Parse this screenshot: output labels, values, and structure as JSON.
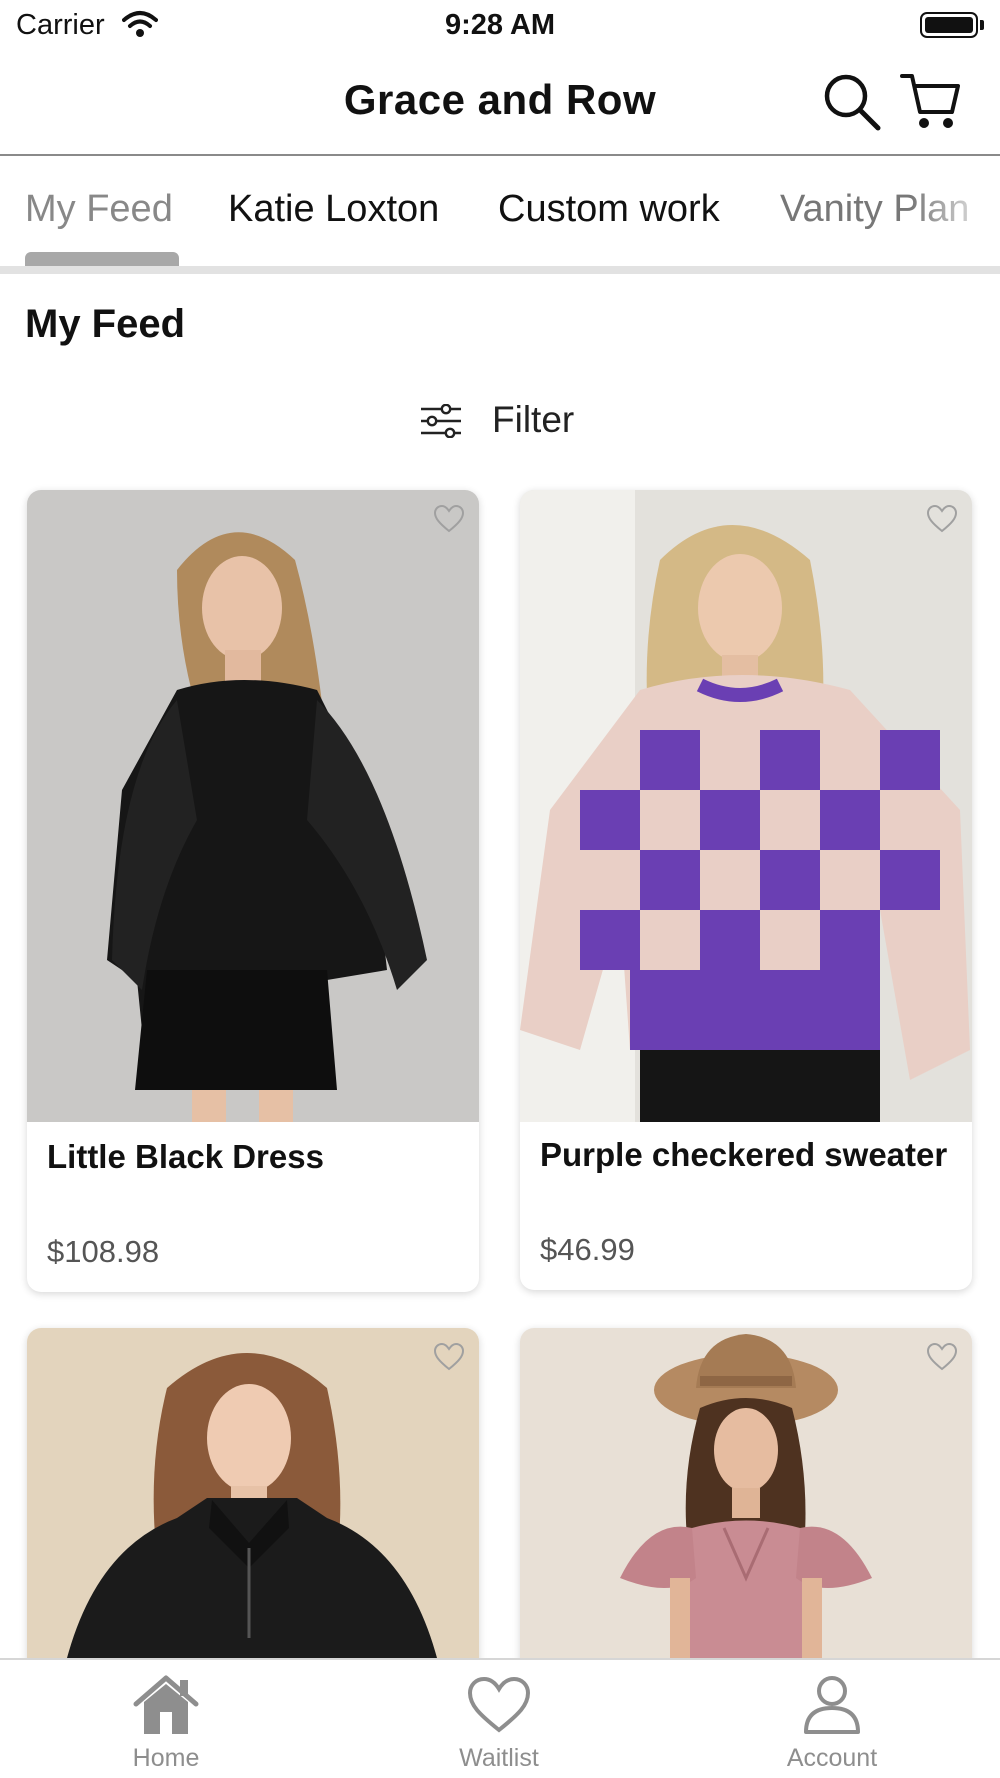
{
  "status_bar": {
    "carrier": "Carrier",
    "time": "9:28 AM"
  },
  "nav": {
    "title": "Grace and Row",
    "search_icon": "search-icon",
    "cart_icon": "cart-icon"
  },
  "tabs": [
    {
      "label": "My Feed",
      "active": true
    },
    {
      "label": "Katie Loxton",
      "active": false
    },
    {
      "label": "Custom work",
      "active": false
    },
    {
      "label": "Vanity Plan",
      "active": false
    }
  ],
  "section": {
    "title": "My Feed",
    "filter_label": "Filter",
    "filter_icon": "sliders-icon"
  },
  "products": [
    {
      "name": "Little Black Dress",
      "price": "$108.98",
      "favorite": false
    },
    {
      "name": "Purple checkered sweater",
      "price": "$46.99",
      "favorite": false
    },
    {
      "name": "",
      "price": "",
      "favorite": false
    },
    {
      "name": "",
      "price": "",
      "favorite": false
    }
  ],
  "tab_bar": [
    {
      "label": "Home",
      "icon": "home-icon"
    },
    {
      "label": "Waitlist",
      "icon": "heart-icon"
    },
    {
      "label": "Account",
      "icon": "person-icon"
    }
  ],
  "colors": {
    "accent_gray": "#a8a8a8",
    "inactive_tab": "#8e8e8e",
    "sweater_purple": "#6a3fb3"
  }
}
